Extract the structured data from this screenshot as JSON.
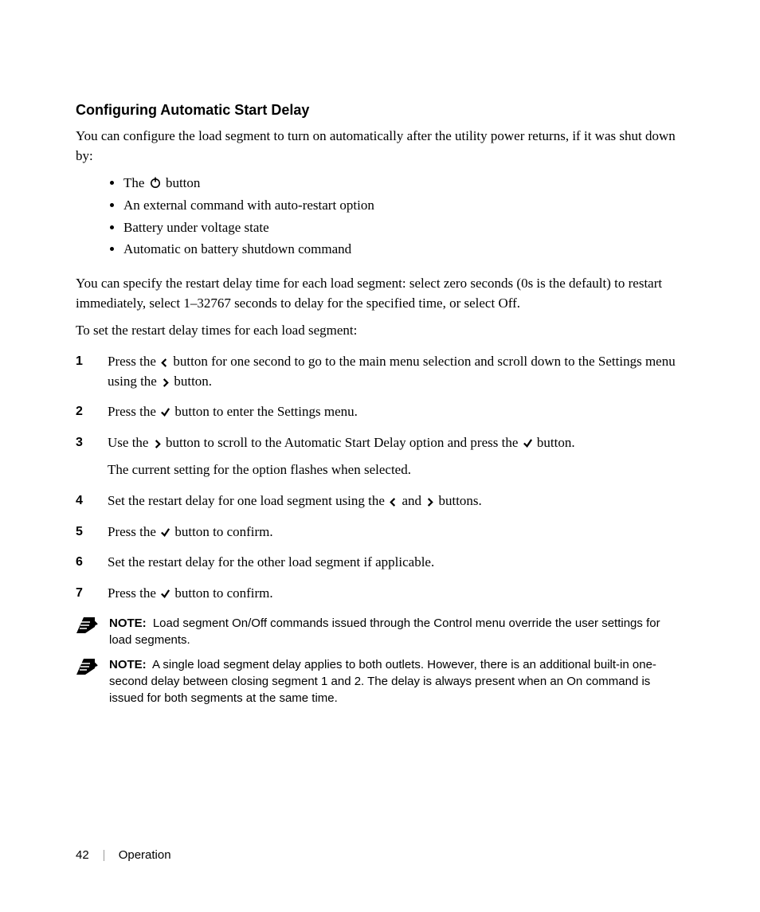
{
  "heading": "Configuring Automatic Start Delay",
  "intro": "You can configure the load segment to turn on automatically after the utility power returns, if it was shut down by:",
  "bullets": {
    "b1_pre": "The ",
    "b1_post": " button",
    "b2": "An external command with auto-restart option",
    "b3": "Battery under voltage state",
    "b4": "Automatic on battery shutdown command"
  },
  "p_after_bullets": "You can specify the restart delay time for each load segment: select zero seconds (0s is the default) to restart immediately, select 1–32767 seconds to delay for the specified time, or select Off.",
  "p_to_set": "To set the restart delay times for each load segment:",
  "steps": {
    "s1_a": "Press the ",
    "s1_b": " button for one second to go to the main menu selection and scroll down to the Settings menu using the ",
    "s1_c": " button.",
    "s2_a": "Press the ",
    "s2_b": " button to enter the Settings menu.",
    "s3_a": "Use the ",
    "s3_b": " button to scroll to the Automatic Start Delay option and press the ",
    "s3_c": " button.",
    "s3_sub": "The current setting for the option flashes when selected.",
    "s4_a": "Set the restart delay for one load segment using the ",
    "s4_b": " and ",
    "s4_c": " buttons.",
    "s5_a": "Press the ",
    "s5_b": " button to confirm.",
    "s6": "Set the restart delay for the other load segment if applicable.",
    "s7_a": "Press the ",
    "s7_b": " button to confirm."
  },
  "notes": {
    "label": "NOTE:",
    "n1": " Load segment On/Off commands issued through the Control menu override the user settings for load segments.",
    "n2": " A single load segment delay applies to both outlets. However, there is an additional built-in one-second delay between closing segment 1 and 2. The delay is always present when an On command is issued for both segments at the same time."
  },
  "footer": {
    "page": "42",
    "section": "Operation"
  }
}
